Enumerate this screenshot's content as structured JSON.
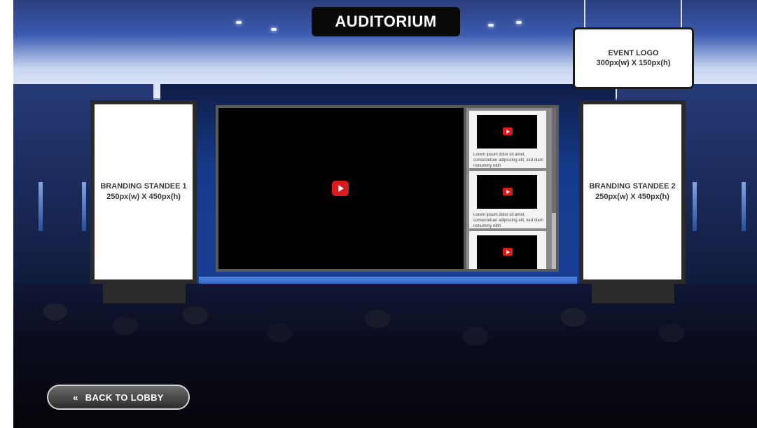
{
  "header": {
    "title": "AUDITORIUM"
  },
  "event_logo": {
    "line1": "EVENT LOGO",
    "line2": "300px(w) X 150px(h)"
  },
  "standee_1": {
    "line1": "BRANDING STANDEE 1",
    "line2": "250px(w) X 450px(h)"
  },
  "standee_2": {
    "line1": "BRANDING STANDEE 2",
    "line2": "250px(w) X 450px(h)"
  },
  "playlist": {
    "items": [
      {
        "description": "Lorem ipsum dolor sit amet, consectetuer adipiscing elit, sed diam nonummy nibh"
      },
      {
        "description": "Lorem ipsum dolor sit amet, consectetuer adipiscing elit, sed diam nonummy nibh"
      },
      {
        "description": ""
      }
    ]
  },
  "back_button": {
    "icon": "«",
    "label": "BACK TO LOBBY"
  },
  "colors": {
    "play_red": "#d81b1b",
    "title_bg": "#0a0a0a"
  },
  "icons": {
    "play": "play-icon",
    "chevrons": "double-chevron-left-icon"
  }
}
